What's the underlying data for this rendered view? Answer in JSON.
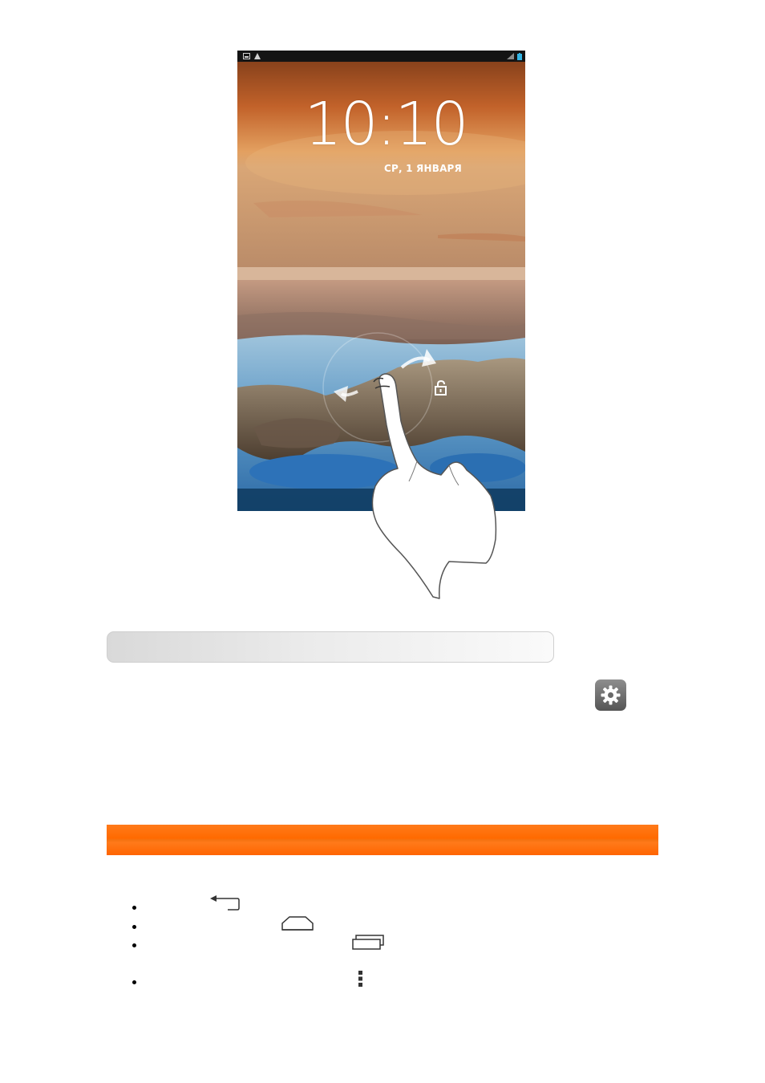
{
  "lock_screen": {
    "time": "10:10",
    "date": "СР, 1 ЯНВАРЯ",
    "status_icons": [
      "image-icon",
      "warning-icon",
      "signal-icon",
      "battery-icon"
    ]
  },
  "icons": {
    "settings": "gear-icon",
    "back": "back-arrow-icon",
    "home": "home-icon",
    "recent": "recent-apps-icon",
    "menu": "menu-dots-icon"
  },
  "colors": {
    "section_bar": "#ff6a00",
    "settings_tile": "#6e6e6e"
  }
}
